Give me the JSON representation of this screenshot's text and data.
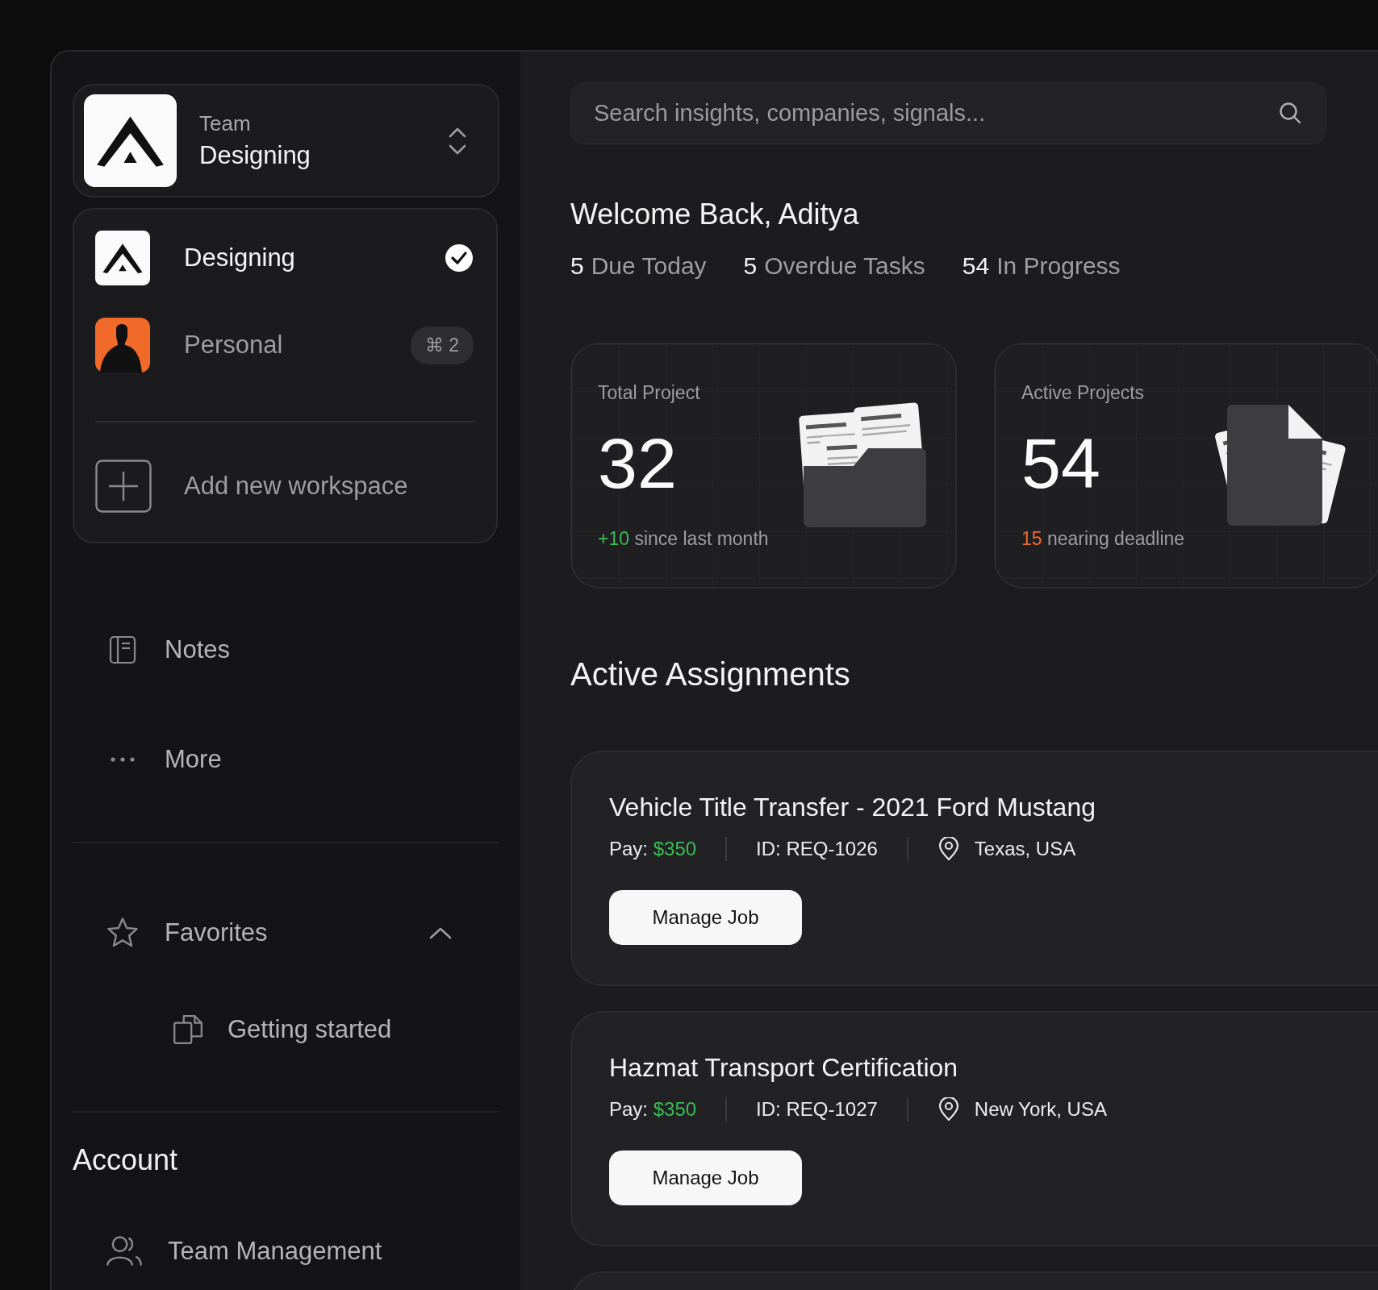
{
  "workspace_switcher": {
    "label": "Team",
    "name": "Designing"
  },
  "workspace_menu": {
    "items": [
      {
        "name": "Designing",
        "kind": "logo",
        "selected": true
      },
      {
        "name": "Personal",
        "kind": "avatar",
        "selected": false,
        "shortcut": "⌘ 2"
      }
    ],
    "add_label": "Add new workspace"
  },
  "sidebar": {
    "items": [
      {
        "label": "Notes",
        "kind": "notes"
      },
      {
        "label": "More",
        "kind": "more"
      }
    ],
    "favorites": {
      "label": "Favorites",
      "expanded": true,
      "items": [
        {
          "label": "Getting started"
        }
      ]
    },
    "account": {
      "title": "Account",
      "items": [
        {
          "label": "Team Management"
        }
      ]
    }
  },
  "search": {
    "placeholder": "Search insights, companies, signals..."
  },
  "welcome": "Welcome Back, Aditya",
  "stats": [
    {
      "count": "5",
      "label": "Due Today"
    },
    {
      "count": "5",
      "label": "Overdue Tasks"
    },
    {
      "count": "54",
      "label": "In Progress"
    }
  ],
  "summary_cards": [
    {
      "title": "Total Project",
      "value": "32",
      "delta": "+10",
      "note": "since last month",
      "color": "#3dbb55",
      "kind": "folder"
    },
    {
      "title": "Active Projects",
      "value": "54",
      "delta": "15",
      "note": "nearing deadline",
      "color": "#f26a2a",
      "kind": "document"
    }
  ],
  "assignments_title": "Active Assignments",
  "assignments": [
    {
      "title": "Vehicle Title Transfer - 2021 Ford Mustang",
      "pay_label": "Pay:",
      "pay": "$350",
      "id": "ID: REQ-1026",
      "location": "Texas, USA",
      "button": "Manage Job"
    },
    {
      "title": "Hazmat Transport Certification",
      "pay_label": "Pay:",
      "pay": "$350",
      "id": "ID: REQ-1027",
      "location": "New York, USA",
      "button": "Manage Job"
    }
  ]
}
